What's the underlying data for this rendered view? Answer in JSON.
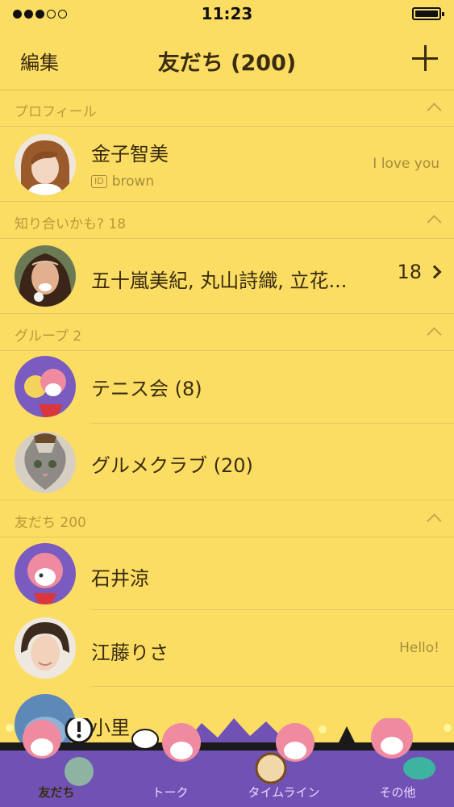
{
  "status_bar": {
    "time": "11:23"
  },
  "nav": {
    "edit_label": "編集",
    "title": "友だち (200)"
  },
  "sections": {
    "profile": {
      "label": "プロフィール"
    },
    "suggested": {
      "label": "知り合いかも? 18"
    },
    "groups": {
      "label": "グループ 2"
    },
    "friends": {
      "label": "友だち 200"
    }
  },
  "profile": {
    "name": "金子智美",
    "id_badge": "ID",
    "id": "brown",
    "status": "I love you"
  },
  "suggested": {
    "names": "五十嵐美紀, 丸山詩織, 立花...",
    "count": "18"
  },
  "groups": [
    {
      "name": "テニス会 (8)"
    },
    {
      "name": "グルメクラブ (20)"
    }
  ],
  "friends": [
    {
      "name": "石井涼",
      "status": ""
    },
    {
      "name": "江藤りさ",
      "status": "Hello!"
    },
    {
      "name": "小里"
    }
  ],
  "tabs": [
    {
      "label": "友だち",
      "active": true
    },
    {
      "label": "トーク",
      "active": false
    },
    {
      "label": "タイムライン",
      "active": false
    },
    {
      "label": "その他",
      "active": false
    }
  ],
  "colors": {
    "background": "#FCDD63",
    "tabbar": "#6F52B4",
    "text": "#3A2C10",
    "subtext": "#B79A3A"
  }
}
